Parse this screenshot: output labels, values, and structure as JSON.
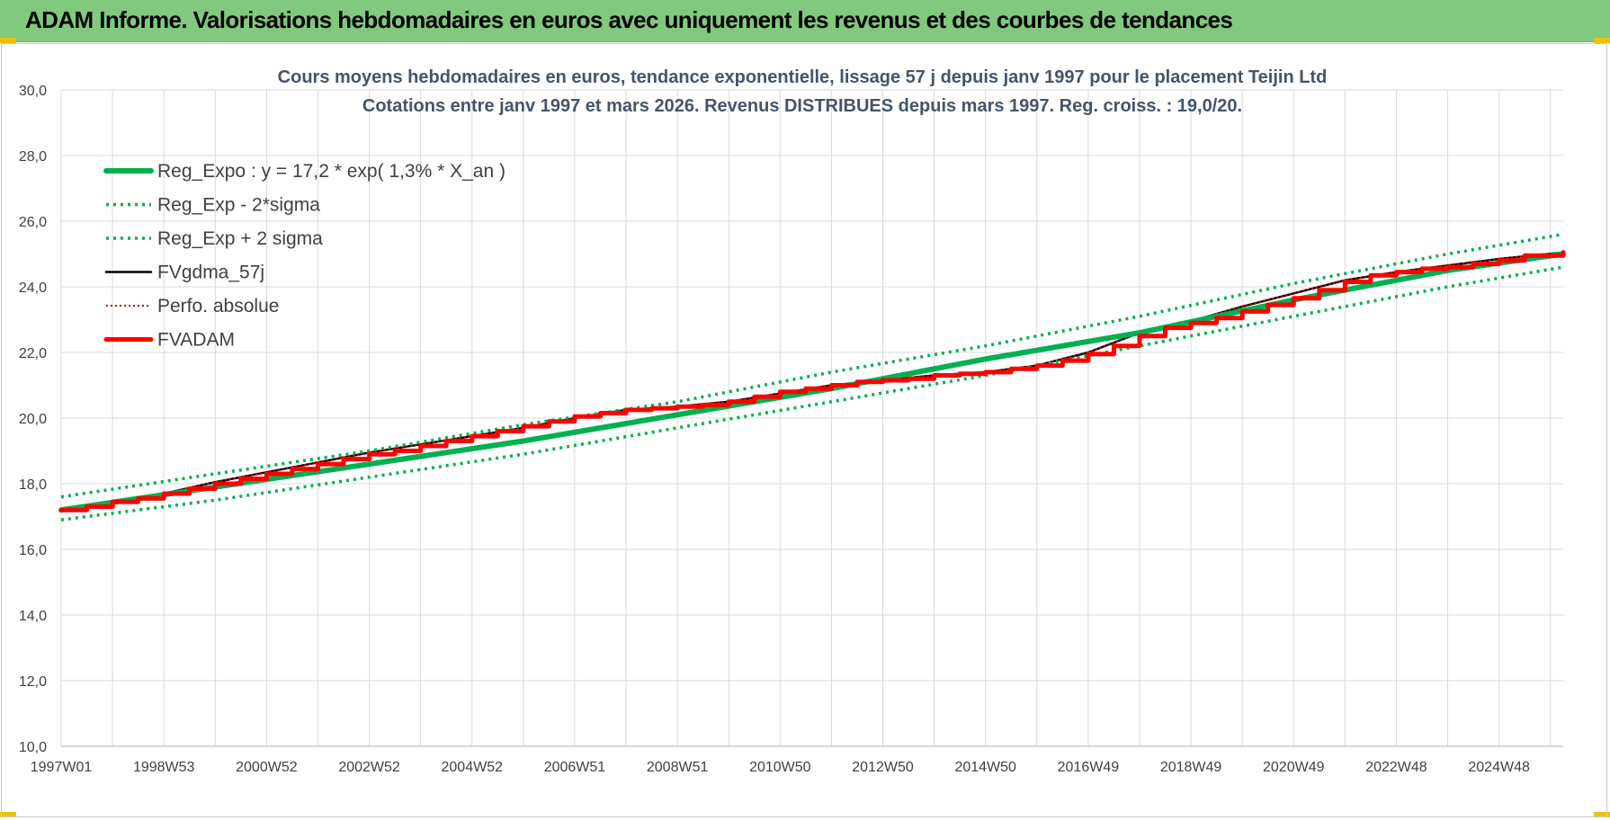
{
  "header": {
    "title": "ADAM Informe. Valorisations hebdomadaires en euros avec uniquement les revenus et des courbes de tendances"
  },
  "colors": {
    "header_bg": "#80c97d",
    "reg_expo": "#00b050",
    "fvadam": "#ff0000",
    "fvgdma": "#000000",
    "perfo": "#c00000",
    "grid": "#d9d9d9",
    "title_text": "#44546a"
  },
  "chart_data": {
    "type": "line",
    "title": "Cours moyens hebdomadaires en euros, tendance exponentielle, lissage 57 j depuis janv 1997  pour le placement Teijin Ltd",
    "subtitle": "Cotations entre janv 1997 et mars 2026. Revenus DISTRIBUES depuis mars 1997. Reg. croiss. : 19,0/20.",
    "xlabel": "",
    "ylabel": "",
    "ylim": [
      10,
      30
    ],
    "xlim": [
      1997.0,
      2026.25
    ],
    "y_ticks": [
      "10,0",
      "12,0",
      "14,0",
      "16,0",
      "18,0",
      "20,0",
      "22,0",
      "24,0",
      "26,0",
      "28,0",
      "30,0"
    ],
    "x_tick_labels": [
      "1997W01",
      "1998W53",
      "2000W52",
      "2002W52",
      "2004W52",
      "2006W51",
      "2008W51",
      "2010W50",
      "2012W50",
      "2014W50",
      "2016W49",
      "2018W49",
      "2020W49",
      "2022W48",
      "2024W48"
    ],
    "grid": true,
    "legend_position": "top-left",
    "legend": [
      "Reg_Expo : y = 17,2 * exp( 1,3% *  X_an )",
      "Reg_Exp - 2*sigma",
      "Reg_Exp + 2 sigma",
      "FVgdma_57j",
      "Perfo. absolue",
      "FVADAM"
    ],
    "series": [
      {
        "name": "Reg_Expo : y = 17,2 * exp( 1,3% *  X_an )",
        "style": "solid-thick",
        "x": [
          1997,
          2000,
          2003,
          2006,
          2009,
          2012,
          2015,
          2018,
          2021,
          2024,
          2026.25
        ],
        "values": [
          17.2,
          17.9,
          18.6,
          19.3,
          20.1,
          20.9,
          21.8,
          22.6,
          23.6,
          24.5,
          25.0
        ]
      },
      {
        "name": "Reg_Exp - 2*sigma",
        "style": "dotted",
        "x": [
          1997,
          2000,
          2003,
          2006,
          2009,
          2012,
          2015,
          2018,
          2021,
          2024,
          2026.25
        ],
        "values": [
          16.9,
          17.5,
          18.2,
          18.9,
          19.7,
          20.5,
          21.3,
          22.2,
          23.1,
          24.0,
          24.6
        ]
      },
      {
        "name": "Reg_Exp + 2 sigma",
        "style": "dotted",
        "x": [
          1997,
          2000,
          2003,
          2006,
          2009,
          2012,
          2015,
          2018,
          2021,
          2024,
          2026.25
        ],
        "values": [
          17.6,
          18.3,
          19.0,
          19.8,
          20.5,
          21.4,
          22.2,
          23.1,
          24.1,
          25.0,
          25.6
        ]
      },
      {
        "name": "FVgdma_57j",
        "style": "solid-thin",
        "x": [
          1997,
          1998,
          1999,
          2000,
          2001,
          2002,
          2003,
          2004,
          2005,
          2006,
          2007,
          2008,
          2009,
          2010,
          2011,
          2012,
          2013,
          2014,
          2015,
          2016,
          2017,
          2018,
          2019,
          2020,
          2021,
          2022,
          2023,
          2024,
          2025,
          2026.25
        ],
        "values": [
          17.2,
          17.45,
          17.7,
          18.05,
          18.35,
          18.65,
          18.95,
          19.2,
          19.45,
          19.7,
          20.0,
          20.25,
          20.35,
          20.5,
          20.75,
          21.0,
          21.15,
          21.3,
          21.4,
          21.6,
          22.0,
          22.6,
          22.95,
          23.4,
          23.8,
          24.2,
          24.45,
          24.65,
          24.85,
          25.05
        ]
      },
      {
        "name": "Perfo. absolue",
        "style": "dotted-thin",
        "x": [
          1997,
          1998,
          1999,
          2000,
          2001,
          2002,
          2003,
          2004,
          2005,
          2006,
          2007,
          2008,
          2009,
          2010,
          2011,
          2012,
          2013,
          2014,
          2015,
          2016,
          2017,
          2018,
          2019,
          2020,
          2021,
          2022,
          2023,
          2024,
          2025,
          2026.25
        ],
        "values": [
          17.2,
          17.45,
          17.7,
          18.05,
          18.35,
          18.65,
          18.95,
          19.2,
          19.45,
          19.7,
          20.0,
          20.25,
          20.35,
          20.5,
          20.75,
          21.0,
          21.15,
          21.3,
          21.4,
          21.6,
          22.0,
          22.6,
          22.95,
          23.4,
          23.8,
          24.2,
          24.45,
          24.65,
          24.85,
          25.05
        ]
      },
      {
        "name": "FVADAM",
        "style": "step-thick",
        "x": [
          1997,
          1997.5,
          1998,
          1998.5,
          1999,
          1999.5,
          2000,
          2000.5,
          2001,
          2001.5,
          2002,
          2002.5,
          2003,
          2003.5,
          2004,
          2004.5,
          2005,
          2005.5,
          2006,
          2006.5,
          2007,
          2007.5,
          2008,
          2008.5,
          2009,
          2009.5,
          2010,
          2010.5,
          2011,
          2011.5,
          2012,
          2012.5,
          2013,
          2013.5,
          2014,
          2014.5,
          2015,
          2015.5,
          2016,
          2016.5,
          2017,
          2017.5,
          2018,
          2018.5,
          2019,
          2019.5,
          2020,
          2020.5,
          2021,
          2021.5,
          2022,
          2022.5,
          2023,
          2023.5,
          2024,
          2024.5,
          2025,
          2025.5,
          2026.25
        ],
        "values": [
          17.2,
          17.3,
          17.45,
          17.55,
          17.7,
          17.85,
          18.0,
          18.15,
          18.3,
          18.45,
          18.6,
          18.75,
          18.9,
          19.0,
          19.15,
          19.3,
          19.45,
          19.6,
          19.75,
          19.9,
          20.05,
          20.15,
          20.25,
          20.3,
          20.35,
          20.4,
          20.5,
          20.65,
          20.8,
          20.9,
          21.0,
          21.1,
          21.15,
          21.2,
          21.3,
          21.35,
          21.4,
          21.5,
          21.6,
          21.75,
          21.95,
          22.2,
          22.5,
          22.75,
          22.9,
          23.05,
          23.25,
          23.45,
          23.65,
          23.9,
          24.15,
          24.35,
          24.45,
          24.55,
          24.6,
          24.7,
          24.8,
          24.95,
          25.05
        ]
      }
    ]
  }
}
